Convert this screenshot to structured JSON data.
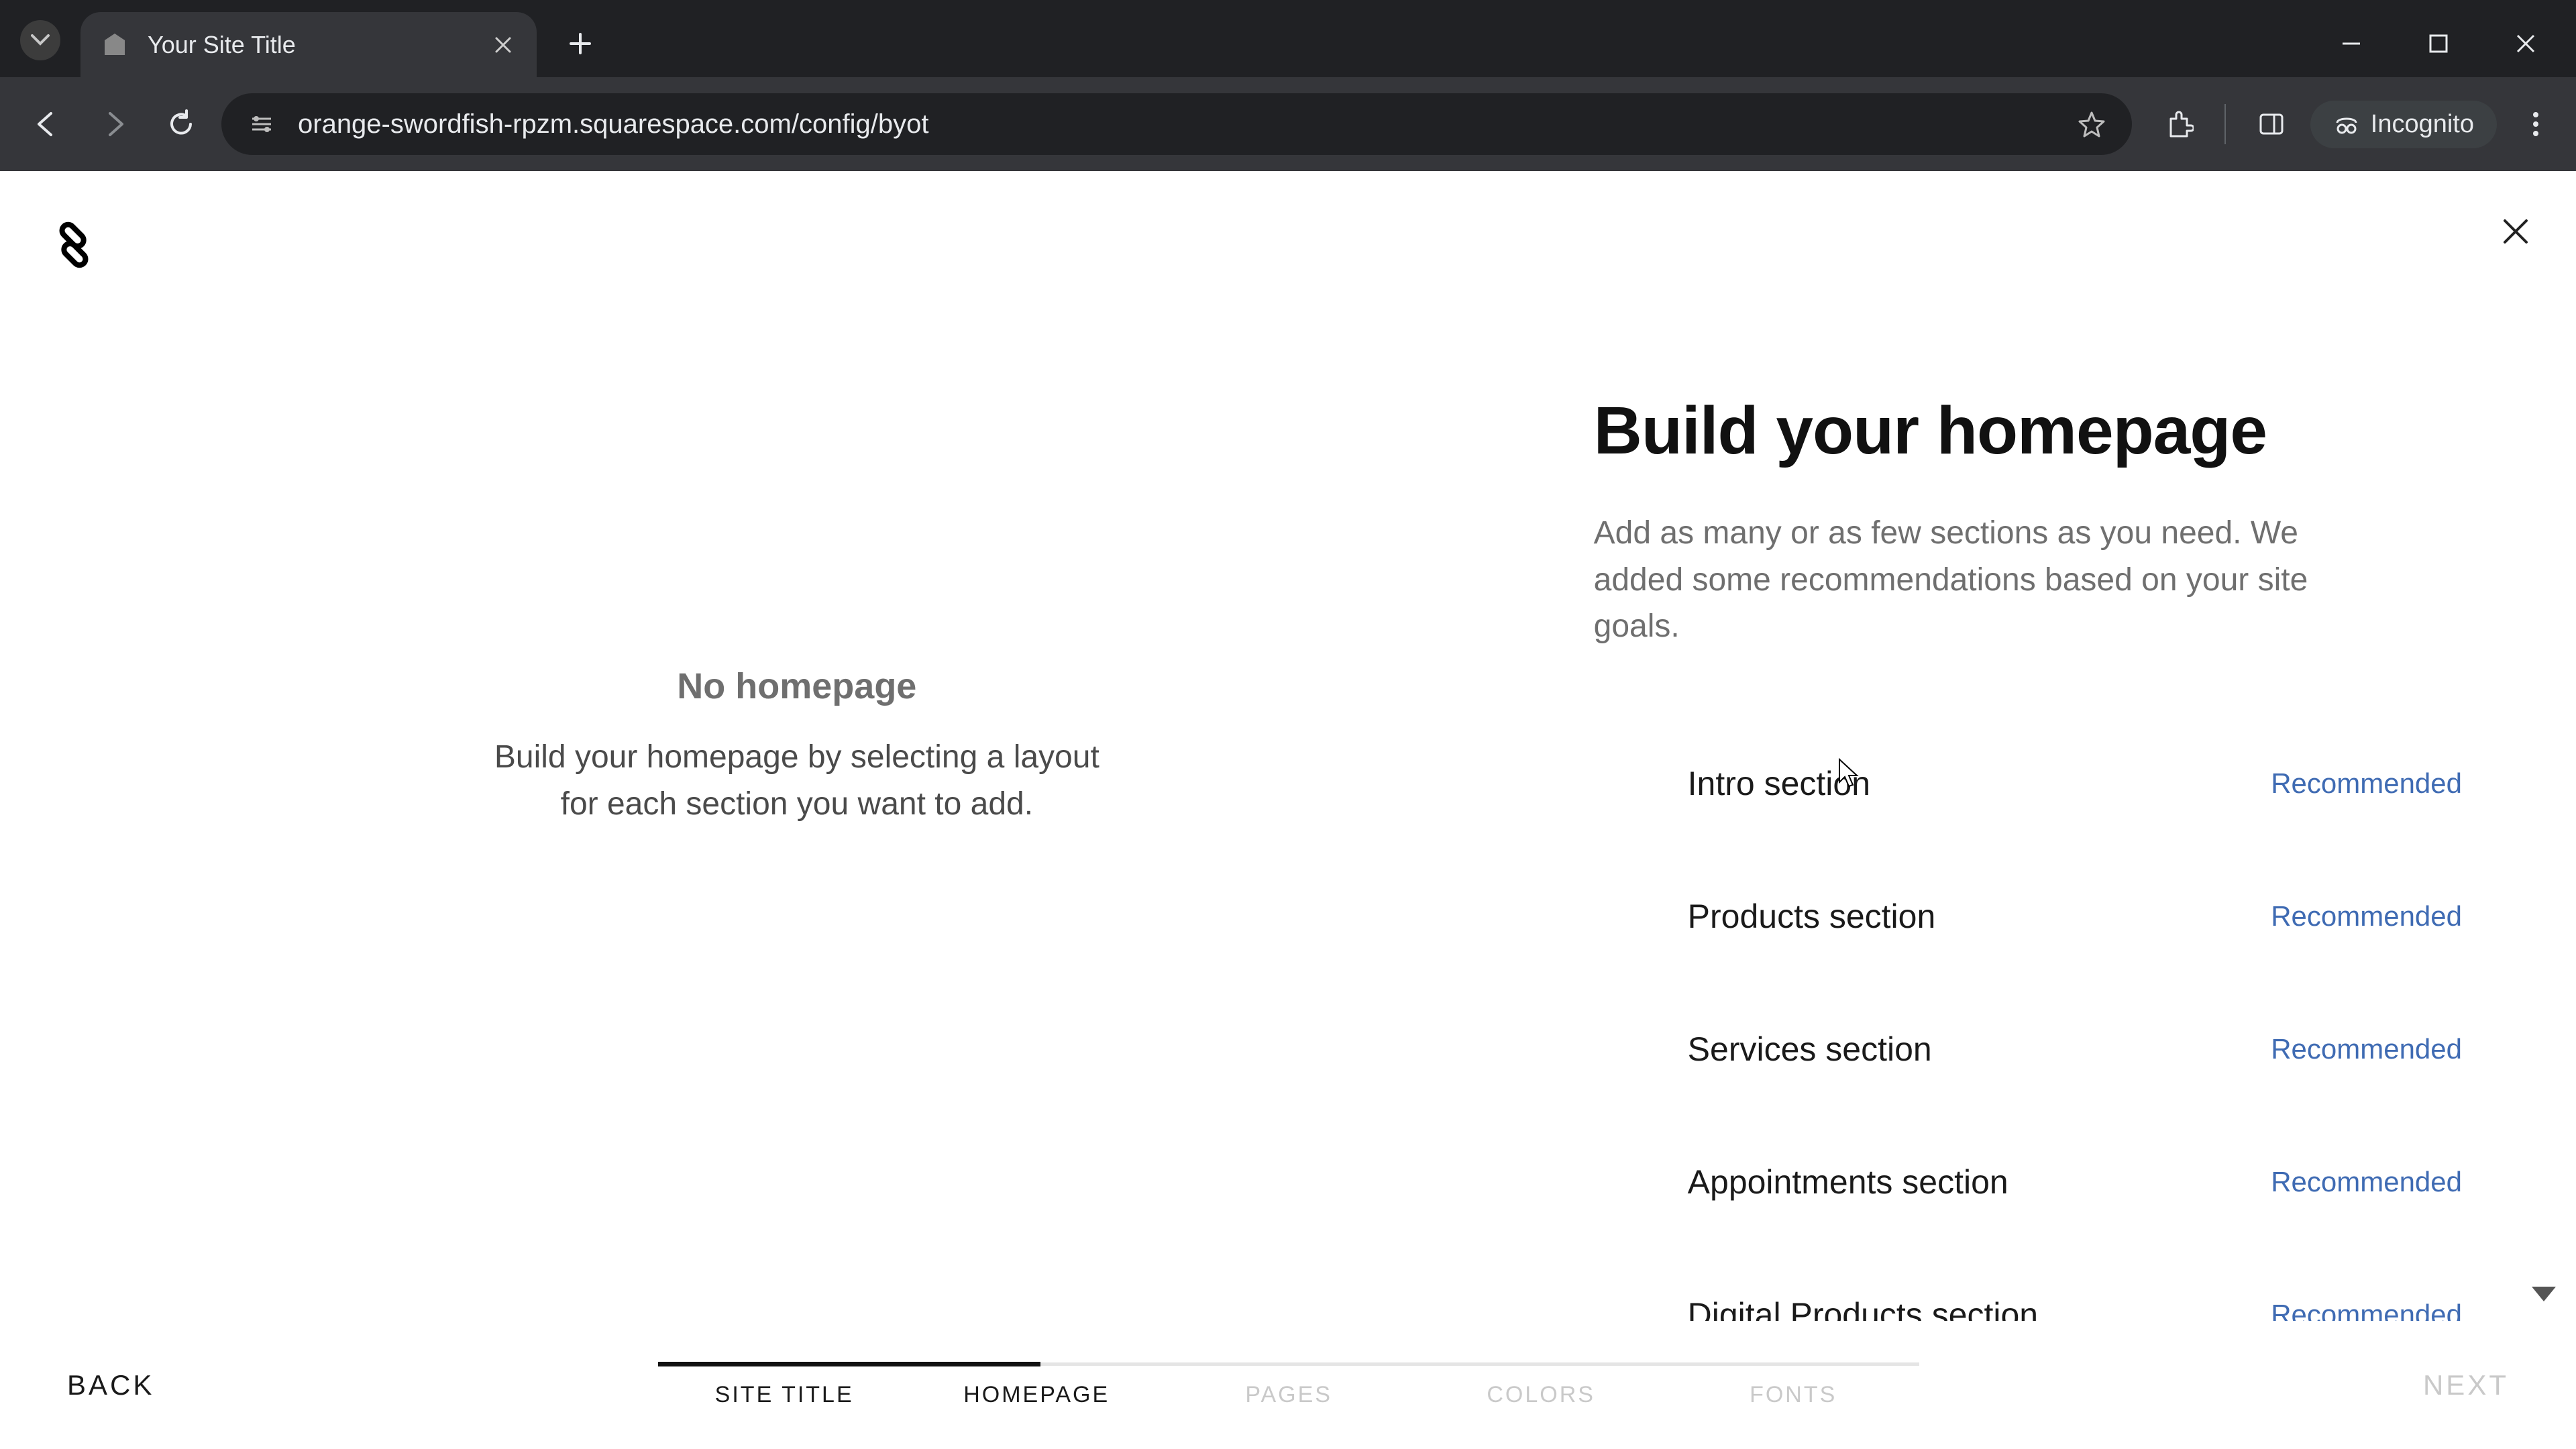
{
  "browser": {
    "tab_title": "Your Site Title",
    "url": "orange-swordfish-rpzm.squarespace.com/config/byot",
    "incognito_label": "Incognito"
  },
  "app": {
    "left": {
      "title": "No homepage",
      "subtitle": "Build your homepage by selecting a layout for each section you want to add."
    },
    "right": {
      "title": "Build your homepage",
      "subtitle": "Add as many or as few sections as you need. We added some recommendations based on your site goals."
    },
    "sections": [
      {
        "name": "Intro section",
        "badge": "Recommended"
      },
      {
        "name": "Products section",
        "badge": "Recommended"
      },
      {
        "name": "Services section",
        "badge": "Recommended"
      },
      {
        "name": "Appointments section",
        "badge": "Recommended"
      },
      {
        "name": "Digital Products section",
        "badge": "Recommended"
      }
    ],
    "footer": {
      "back": "BACK",
      "next": "NEXT",
      "steps": [
        {
          "label": "SITE TITLE",
          "state": "done"
        },
        {
          "label": "HOMEPAGE",
          "state": "done"
        },
        {
          "label": "PAGES",
          "state": "pending"
        },
        {
          "label": "COLORS",
          "state": "pending"
        },
        {
          "label": "FONTS",
          "state": "pending"
        }
      ]
    }
  }
}
